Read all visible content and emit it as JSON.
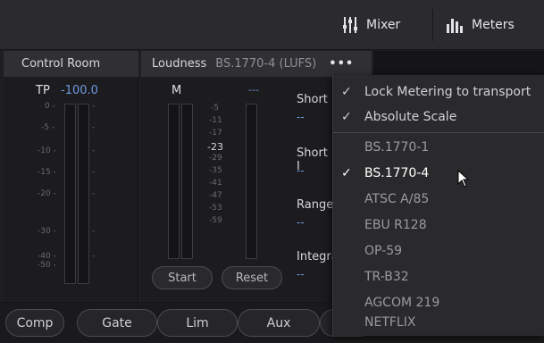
{
  "toolbar": {
    "mixer_label": "Mixer",
    "meters_label": "Meters"
  },
  "control_room": {
    "title": "Control Room",
    "tp_label": "TP",
    "tp_value": "-100.0",
    "ticks": [
      "0 -",
      "-5 -",
      "-10 -",
      "-15 -",
      "-20 -",
      "-30 -",
      "-40 -",
      "-50 -"
    ]
  },
  "loudness": {
    "title": "Loudness",
    "standard": "BS.1770-4 (LUFS)",
    "options_label": "•••",
    "m_label": "M",
    "m_value": "---",
    "ticks": [
      "-5",
      "-11",
      "-17",
      "-23",
      "-29",
      "-35",
      "-41",
      "-47",
      "-53",
      "-59"
    ],
    "highlight_tick": "-23",
    "start_label": "Start",
    "reset_label": "Reset",
    "stats": [
      {
        "label": "Short",
        "value": "--"
      },
      {
        "label": "Short I",
        "value": "--"
      },
      {
        "label": "Range",
        "value": "--"
      },
      {
        "label": "Integra",
        "value": "--"
      }
    ]
  },
  "bottom_tabs": [
    "Comp",
    "Gate",
    "Lim",
    "Aux"
  ],
  "menu": {
    "toggles": [
      {
        "label": "Lock Metering to transport",
        "checked": true
      },
      {
        "label": "Absolute Scale",
        "checked": true
      }
    ],
    "standards": [
      {
        "label": "BS.1770-1",
        "checked": false
      },
      {
        "label": "BS.1770-4",
        "checked": true
      },
      {
        "label": "ATSC A/85",
        "checked": false
      },
      {
        "label": "EBU R128",
        "checked": false
      },
      {
        "label": "OP-59",
        "checked": false
      },
      {
        "label": "TR-B32",
        "checked": false
      },
      {
        "label": "AGCOM 219",
        "checked": false
      },
      {
        "label": "NETFLIX",
        "checked": false
      }
    ],
    "check_glyph": "✓"
  },
  "colors": {
    "accent_value": "#6f9ae0",
    "background": "#1c1c1e",
    "menu_background": "#2a2a2d"
  },
  "icons": {
    "mixer": "mixer-faders-icon",
    "meters": "meters-bars-icon",
    "cursor": "mouse-pointer-icon"
  }
}
